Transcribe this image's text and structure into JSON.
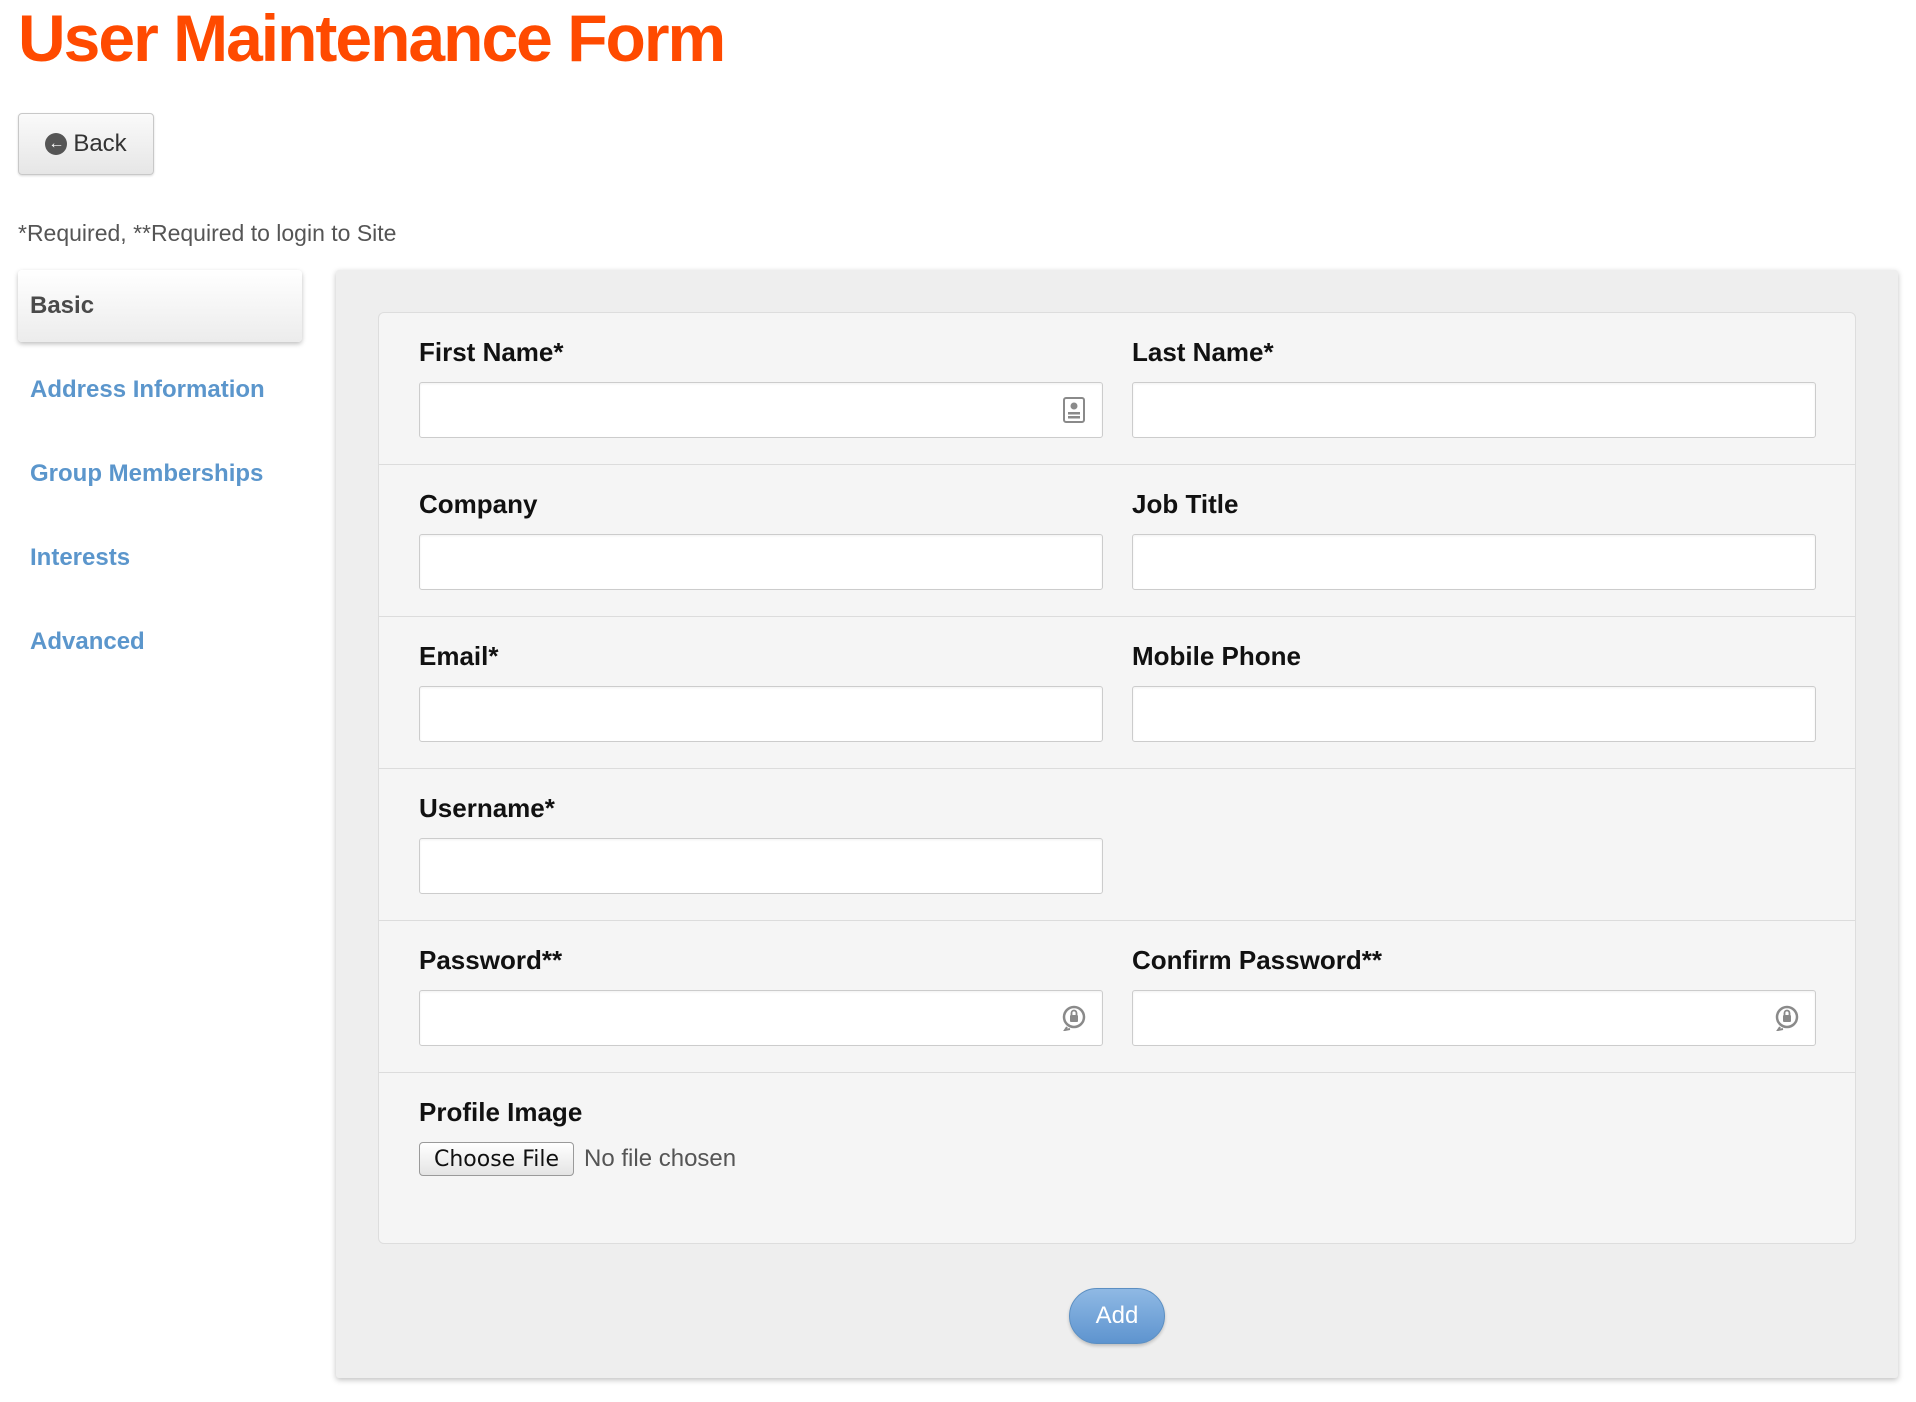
{
  "page": {
    "title": "User Maintenance Form",
    "back_label": "Back",
    "required_note": "*Required, **Required to login to Site"
  },
  "sidebar": {
    "items": [
      {
        "label": "Basic",
        "active": true
      },
      {
        "label": "Address Information",
        "active": false
      },
      {
        "label": "Group Memberships",
        "active": false
      },
      {
        "label": "Interests",
        "active": false
      },
      {
        "label": "Advanced",
        "active": false
      }
    ]
  },
  "form": {
    "first_name": {
      "label": "First Name*",
      "value": "",
      "icon": "contact-card-icon"
    },
    "last_name": {
      "label": "Last Name*",
      "value": ""
    },
    "company": {
      "label": "Company",
      "value": ""
    },
    "job_title": {
      "label": "Job Title",
      "value": ""
    },
    "email": {
      "label": "Email*",
      "value": ""
    },
    "mobile_phone": {
      "label": "Mobile Phone",
      "value": ""
    },
    "username": {
      "label": "Username*",
      "value": ""
    },
    "password": {
      "label": "Password**",
      "value": "",
      "icon": "password-key-icon"
    },
    "confirm_password": {
      "label": "Confirm Password**",
      "value": "",
      "icon": "password-key-icon"
    },
    "profile_image": {
      "label": "Profile Image",
      "button_label": "Choose File",
      "status": "No file chosen"
    },
    "submit_label": "Add"
  },
  "colors": {
    "title": "#ff4a00",
    "link": "#5b96cc",
    "primary_button": "#6fa3d8"
  }
}
